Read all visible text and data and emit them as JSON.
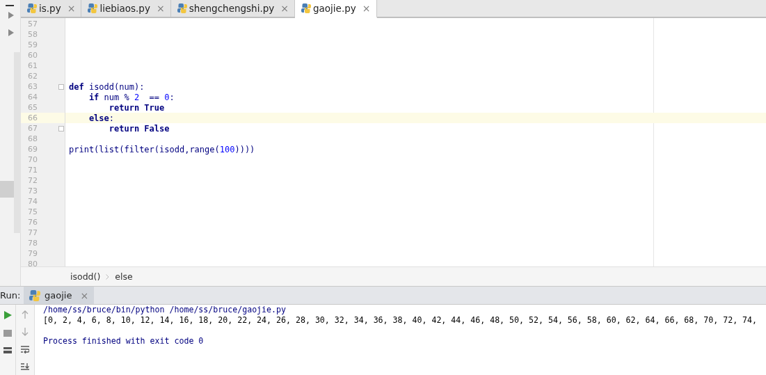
{
  "tabs": [
    {
      "label": "is.py",
      "close": "×",
      "selected": false
    },
    {
      "label": "liebiaos.py",
      "close": "×",
      "selected": false
    },
    {
      "label": "shengchengshi.py",
      "close": "×",
      "selected": false
    },
    {
      "label": "gaojie.py",
      "close": "×",
      "selected": true
    }
  ],
  "editor": {
    "lines": [
      {
        "number": "57",
        "current": false
      },
      {
        "number": "58",
        "current": false
      },
      {
        "number": "59",
        "current": false
      },
      {
        "number": "60",
        "current": false
      },
      {
        "number": "61",
        "current": false
      },
      {
        "number": "62",
        "current": false
      },
      {
        "number": "63",
        "current": false,
        "fold_marker": true,
        "tokens": [
          {
            "kind": "keyword",
            "text": "def"
          },
          {
            "kind": "plain",
            "text": " isodd(num):"
          }
        ]
      },
      {
        "number": "64",
        "current": false,
        "tokens": [
          {
            "kind": "keyword",
            "text": "    if"
          },
          {
            "kind": "plain",
            "text": " num % "
          },
          {
            "kind": "number",
            "text": "2"
          },
          {
            "kind": "plain",
            "text": "  == "
          },
          {
            "kind": "number",
            "text": "0"
          },
          {
            "kind": "plain",
            "text": ":"
          }
        ]
      },
      {
        "number": "65",
        "current": false,
        "tokens": [
          {
            "kind": "keyword",
            "text": "        return True"
          }
        ]
      },
      {
        "number": "66",
        "current": true,
        "tokens": [
          {
            "kind": "keyword",
            "text": "    else"
          },
          {
            "kind": "plain",
            "text": ":"
          }
        ]
      },
      {
        "number": "67",
        "current": false,
        "fold_marker": true,
        "tokens": [
          {
            "kind": "keyword",
            "text": "        return False"
          }
        ]
      },
      {
        "number": "68",
        "current": false
      },
      {
        "number": "69",
        "current": false,
        "tokens": [
          {
            "kind": "plain",
            "text": "print(list(filter(isodd,range("
          },
          {
            "kind": "number",
            "text": "100"
          },
          {
            "kind": "plain",
            "text": "))))"
          }
        ]
      },
      {
        "number": "70",
        "current": false
      },
      {
        "number": "71",
        "current": false
      },
      {
        "number": "72",
        "current": false
      },
      {
        "number": "73",
        "current": false
      },
      {
        "number": "74",
        "current": false
      },
      {
        "number": "75",
        "current": false
      },
      {
        "number": "76",
        "current": false
      },
      {
        "number": "77",
        "current": false
      },
      {
        "number": "78",
        "current": false
      },
      {
        "number": "79",
        "current": false
      },
      {
        "number": "80",
        "current": false
      }
    ]
  },
  "breadcrumbs": [
    "isodd()",
    "else"
  ],
  "run_panel": {
    "label": "Run:",
    "tab": {
      "label": "gaojie",
      "close": "×",
      "selected": true
    },
    "output": [
      {
        "kind": "command",
        "text": "/home/ss/bruce/bin/python /home/ss/bruce/gaojie.py"
      },
      {
        "kind": "stdout",
        "text": "[0, 2, 4, 6, 8, 10, 12, 14, 16, 18, 20, 22, 24, 26, 28, 30, 32, 34, 36, 38, 40, 42, 44, 46, 48, 50, 52, 54, 56, 58, 60, 62, 64, 66, 68, 70, 72, 74,"
      },
      {
        "kind": "blank"
      },
      {
        "kind": "status",
        "text": "Process finished with exit code 0"
      }
    ]
  }
}
